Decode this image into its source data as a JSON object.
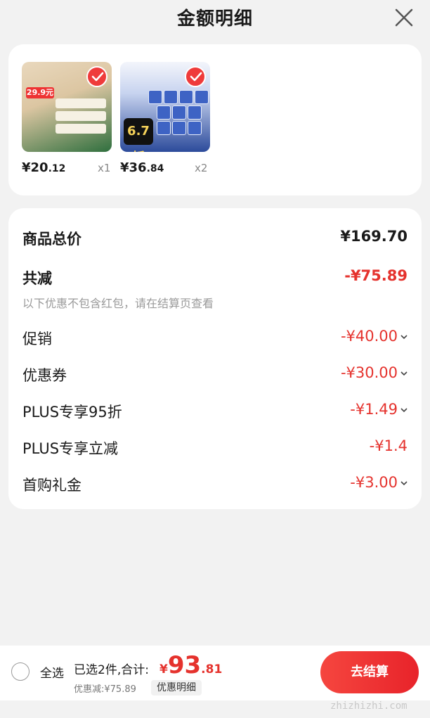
{
  "header": {
    "title": "金额明细"
  },
  "products": [
    {
      "price_int": "¥20",
      "price_dec": ".12",
      "qty": "x1",
      "badge": "29.9元"
    },
    {
      "price_int": "¥36",
      "price_dec": ".84",
      "qty": "x2",
      "badge": "6.7折"
    }
  ],
  "summary": {
    "total_label": "商品总价",
    "total_value": "¥169.70",
    "reduce_label": "共减",
    "reduce_value": "-¥75.89",
    "note": "以下优惠不包含红包，请在结算页查看",
    "items": [
      {
        "label": "促销",
        "value": "-¥40.00"
      },
      {
        "label": "优惠券",
        "value": "-¥30.00"
      },
      {
        "label": "PLUS专享95折",
        "value": "-¥1.49"
      },
      {
        "label": "PLUS专享立减",
        "value": "-¥1.4"
      },
      {
        "label": "首购礼金",
        "value": "-¥3.00"
      }
    ]
  },
  "bottom": {
    "select_all": "全选",
    "selected_info": "已选2件,合计:",
    "total_symbol": "¥",
    "total_int": "93",
    "total_dec": ".81",
    "discount": "优惠减:¥75.89",
    "detail_link": "优惠明细",
    "checkout": "去结算"
  },
  "watermark": "zhizhizhi.com",
  "colors": {
    "accent_red": "#e5322d",
    "background": "#f2f2f2"
  }
}
